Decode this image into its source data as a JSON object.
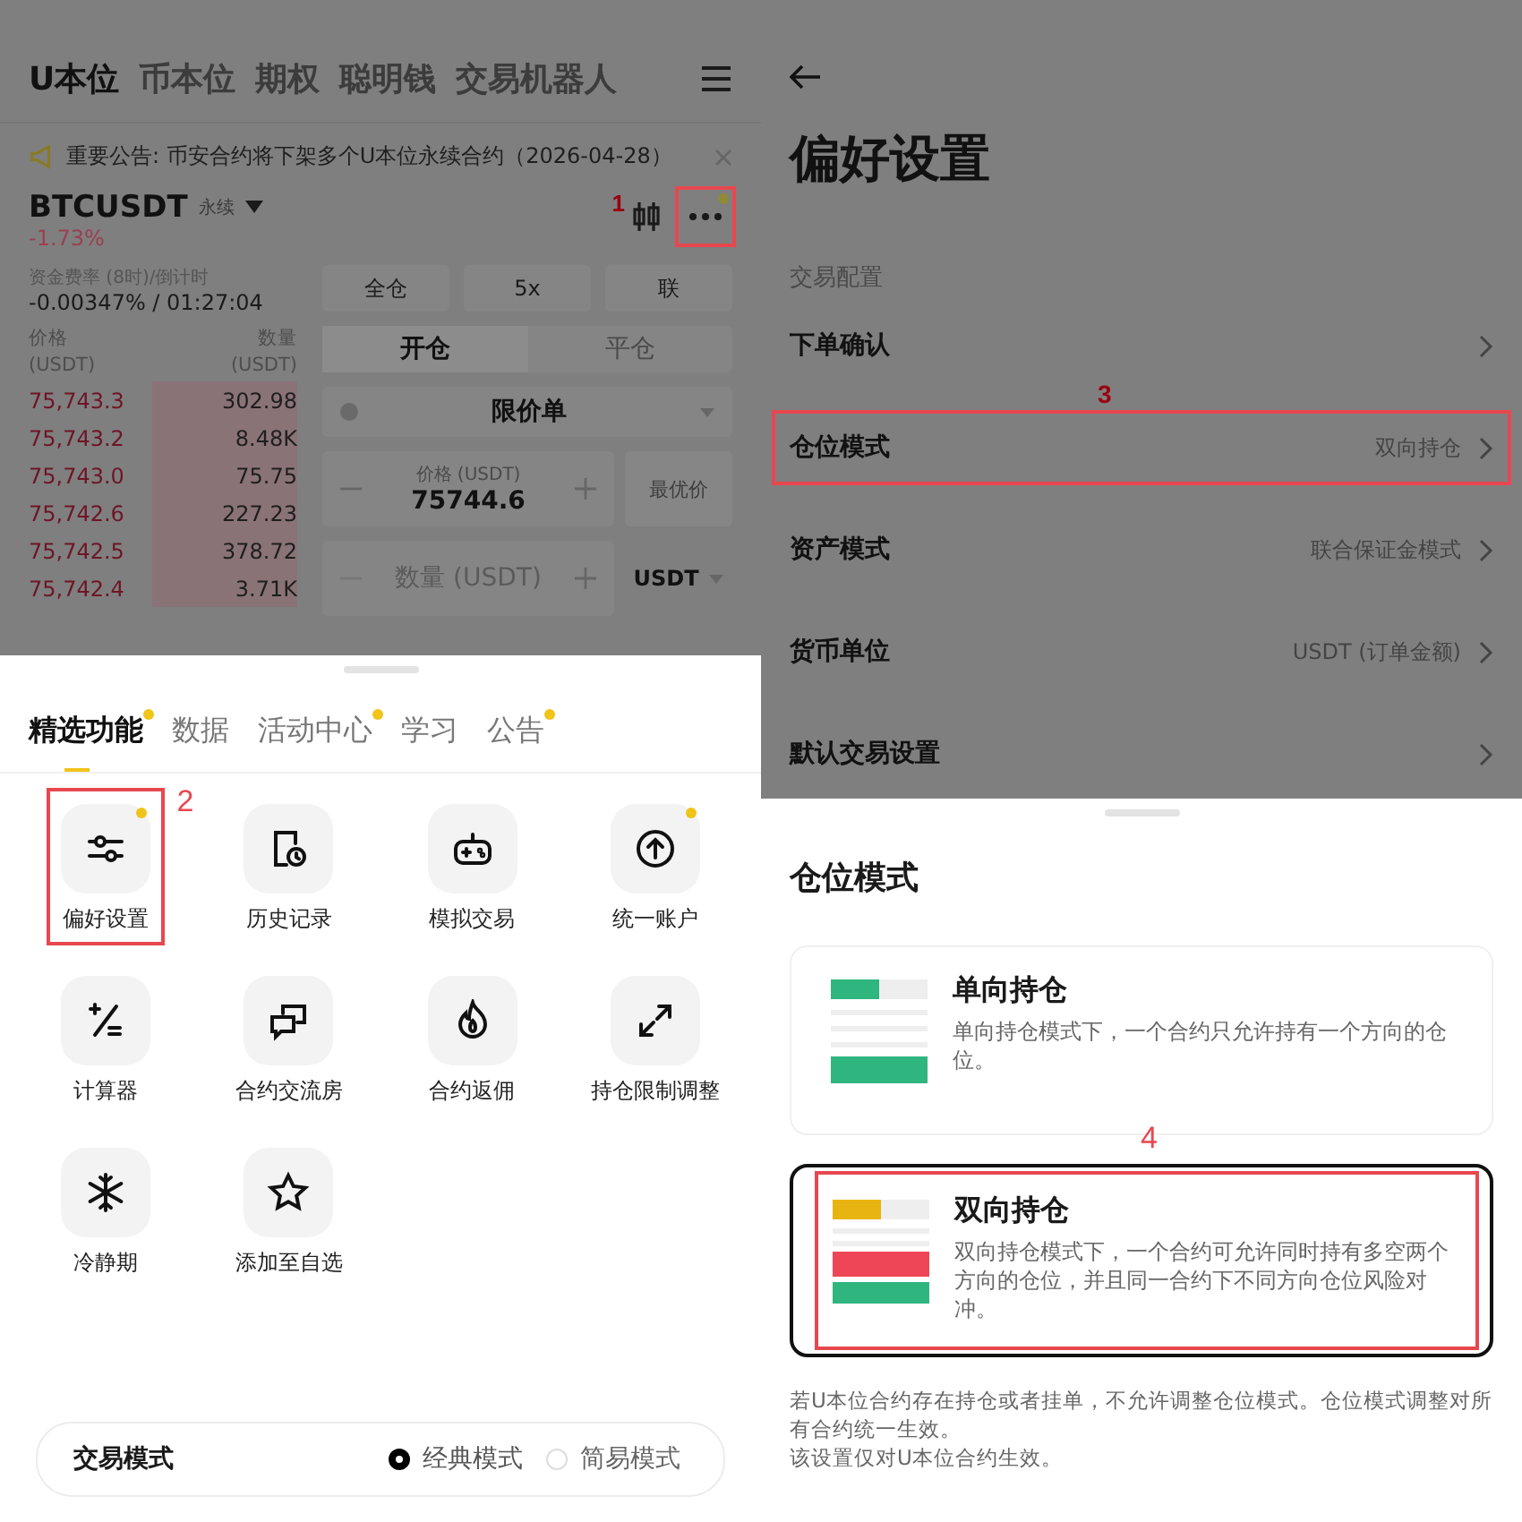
{
  "left_screen": {
    "top_tabs": [
      {
        "label": "U本位",
        "selected": true
      },
      {
        "label": "币本位",
        "selected": false
      },
      {
        "label": "期权",
        "selected": false
      },
      {
        "label": "聪明钱",
        "selected": false
      },
      {
        "label": "交易机器人",
        "selected": false
      }
    ],
    "announcement": {
      "text": "重要公告: 币安合约将下架多个U本位永续合约（2026-04-28）"
    },
    "symbol": {
      "name": "BTCUSDT",
      "badge": "永续",
      "change": "-1.73%",
      "more_dot": true,
      "more_annotation": "1"
    },
    "funding": {
      "label": "资金费率 (8时)/倒计时",
      "value": "-0.00347% / 01:27:04"
    },
    "order_book": {
      "columns": [
        {
          "label": "价格",
          "unit": "(USDT)"
        },
        {
          "label": "数量",
          "unit": "(USDT)"
        }
      ],
      "rows": [
        {
          "price": "75,743.3",
          "amount": "302.98"
        },
        {
          "price": "75,743.2",
          "amount": "8.48K"
        },
        {
          "price": "75,743.0",
          "amount": "75.75"
        },
        {
          "price": "75,742.6",
          "amount": "227.23"
        },
        {
          "price": "75,742.5",
          "amount": "378.72"
        },
        {
          "price": "75,742.4",
          "amount": "3.71K"
        }
      ]
    },
    "margin_buttons": [
      "全仓",
      "5x",
      "联"
    ],
    "position_tabs": [
      {
        "label": "开仓",
        "selected": true
      },
      {
        "label": "平仓",
        "selected": false
      }
    ],
    "order_type": "限价单",
    "price_field": {
      "label": "价格 (USDT)",
      "value": "75744.6",
      "best_price": "最优价"
    },
    "amount_field": {
      "placeholder": "数量 (USDT)",
      "unit": "USDT"
    },
    "sheet": {
      "tabs": [
        {
          "label": "精选功能",
          "selected": true,
          "dot": true
        },
        {
          "label": "数据",
          "selected": false,
          "dot": false
        },
        {
          "label": "活动中心",
          "selected": false,
          "dot": true
        },
        {
          "label": "学习",
          "selected": false,
          "dot": false
        },
        {
          "label": "公告",
          "selected": false,
          "dot": true
        }
      ],
      "features": [
        {
          "label": "偏好设置",
          "dot": true,
          "annotation": "2"
        },
        {
          "label": "历史记录",
          "dot": false
        },
        {
          "label": "模拟交易",
          "dot": false
        },
        {
          "label": "统一账户",
          "dot": true
        },
        {
          "label": "计算器",
          "dot": false
        },
        {
          "label": "合约交流房",
          "dot": false
        },
        {
          "label": "合约返佣",
          "dot": false
        },
        {
          "label": "持仓限制调整",
          "dot": false
        },
        {
          "label": "冷静期",
          "dot": false
        },
        {
          "label": "添加至自选",
          "dot": false
        }
      ],
      "trade_mode": {
        "label": "交易模式",
        "options": [
          {
            "label": "经典模式",
            "selected": true
          },
          {
            "label": "简易模式",
            "selected": false
          }
        ]
      }
    }
  },
  "right_screen": {
    "title": "偏好设置",
    "section": "交易配置",
    "rows": [
      {
        "label": "下单确认"
      },
      {
        "label": "仓位模式",
        "value": "双向持仓",
        "annotation": "3"
      },
      {
        "label": "资产模式",
        "value": "联合保证金模式"
      },
      {
        "label": "货币单位",
        "value": "USDT (订单金额)"
      },
      {
        "label": "默认交易设置"
      }
    ],
    "sheet": {
      "title": "仓位模式",
      "options": [
        {
          "kind": "one_way",
          "title": "单向持仓",
          "description": "单向持仓模式下，一个合约只允许持有一个方向的仓位。",
          "selected": false
        },
        {
          "kind": "hedge",
          "title": "双向持仓",
          "description": "双向持仓模式下，一个合约可允许同时持有多空两个方向的仓位，并且同一合约下不同方向仓位风险对冲。",
          "selected": true,
          "annotation": "4"
        }
      ],
      "notes": [
        "若U本位合约存在持仓或者挂单，不允许调整仓位模式。仓位模式调整对所有合约统一生效。",
        "该设置仅对U本位合约生效。"
      ]
    }
  }
}
